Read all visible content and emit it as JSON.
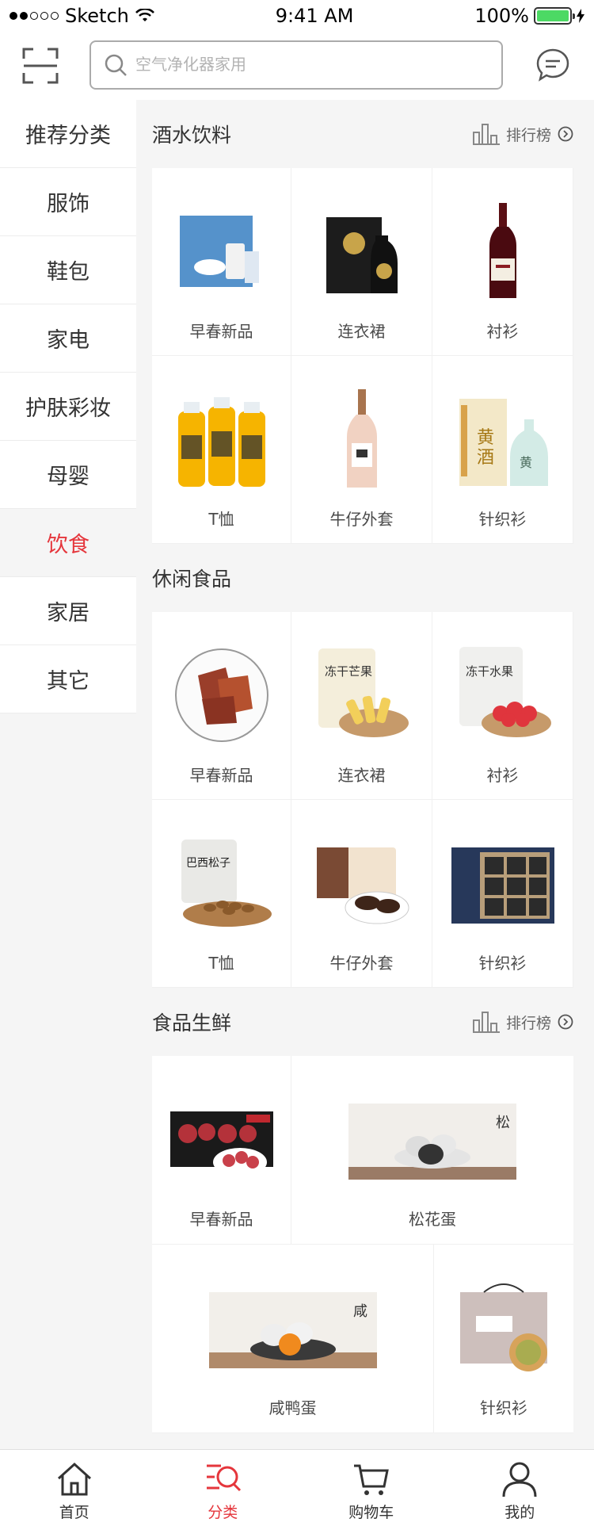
{
  "status_bar": {
    "carrier": "Sketch",
    "time": "9:41 AM",
    "battery": "100%"
  },
  "search": {
    "placeholder": "空气净化器家用"
  },
  "sidebar": {
    "items": [
      {
        "label": "推荐分类"
      },
      {
        "label": "服饰"
      },
      {
        "label": "鞋包"
      },
      {
        "label": "家电"
      },
      {
        "label": "护肤彩妆"
      },
      {
        "label": "母婴"
      },
      {
        "label": "饮食"
      },
      {
        "label": "家居"
      },
      {
        "label": "其它"
      }
    ],
    "active_index": 6
  },
  "sections": [
    {
      "title": "酒水饮料",
      "rank_label": "排行榜",
      "items": [
        {
          "label": "早春新品",
          "icon": "milk-box-image"
        },
        {
          "label": "连衣裙",
          "icon": "liquor-bottle-image"
        },
        {
          "label": "衬衫",
          "icon": "wine-bottle-image"
        },
        {
          "label": "T恤",
          "icon": "juice-bottles-image"
        },
        {
          "label": "牛仔外套",
          "icon": "rose-wine-image"
        },
        {
          "label": "针织衫",
          "icon": "yellow-wine-image"
        }
      ]
    },
    {
      "title": "休闲食品",
      "items": [
        {
          "label": "早春新品",
          "icon": "jerky-plate-image"
        },
        {
          "label": "连衣裙",
          "icon": "mango-snack-image"
        },
        {
          "label": "衬衫",
          "icon": "strawberry-snack-image"
        },
        {
          "label": "T恤",
          "icon": "pine-nuts-image"
        },
        {
          "label": "牛仔外套",
          "icon": "chocolate-pie-image"
        },
        {
          "label": "针织衫",
          "icon": "gift-box-image"
        }
      ]
    },
    {
      "title": "食品生鲜",
      "rank_label": "排行榜",
      "items": [
        {
          "label": "早春新品",
          "icon": "sausage-image"
        },
        {
          "label": "松花蛋",
          "icon": "preserved-egg-image"
        },
        {
          "label": "咸鸭蛋",
          "icon": "salted-egg-image"
        },
        {
          "label": "针织衫",
          "icon": "meat-pie-image"
        }
      ]
    }
  ],
  "tabbar": {
    "items": [
      {
        "label": "首页",
        "icon": "home-icon"
      },
      {
        "label": "分类",
        "icon": "category-icon"
      },
      {
        "label": "购物车",
        "icon": "cart-icon"
      },
      {
        "label": "我的",
        "icon": "user-icon"
      }
    ],
    "active_index": 1
  },
  "colors": {
    "accent": "#e5363c",
    "background": "#f5f5f5"
  }
}
